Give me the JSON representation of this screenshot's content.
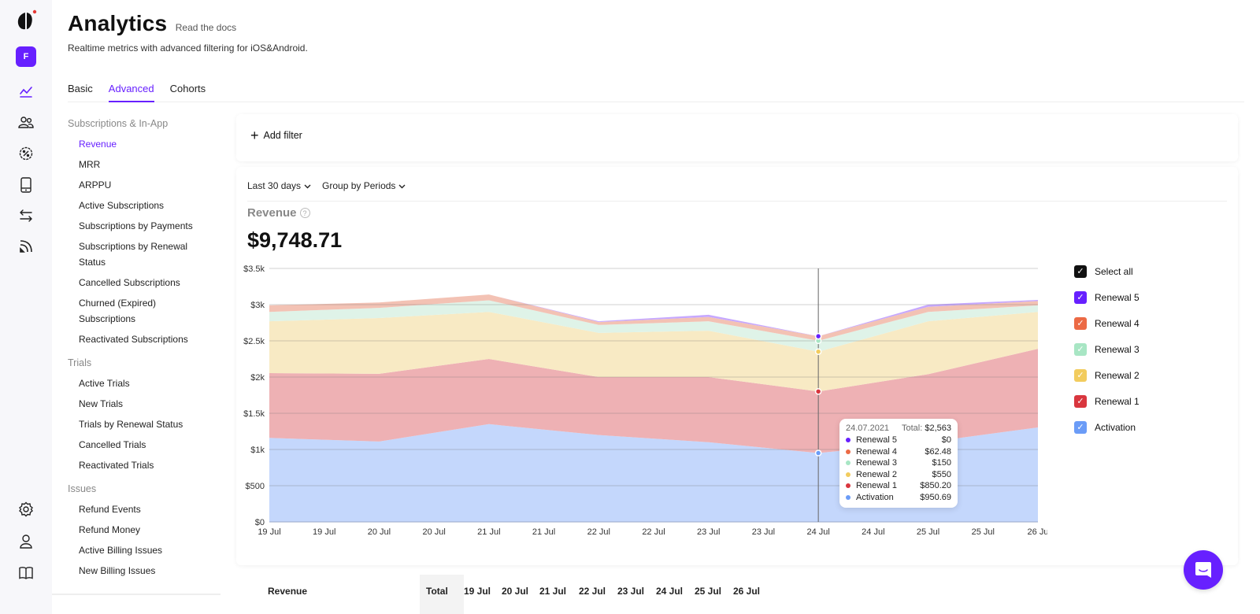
{
  "app": {
    "logo_icon": "brand-logo-icon",
    "avatar_letter": "F",
    "rail_icons": [
      "analytics-icon",
      "users-icon",
      "discount-icon",
      "device-icon",
      "transfer-icon",
      "feed-icon"
    ],
    "rail_bottom_icons": [
      "settings-icon",
      "profile-icon",
      "docs-book-icon"
    ]
  },
  "header": {
    "title": "Analytics",
    "docs_link": "Read the docs",
    "subtitle": "Realtime metrics with advanced filtering for iOS&Android."
  },
  "tabs": [
    {
      "label": "Basic",
      "active": false
    },
    {
      "label": "Advanced",
      "active": true
    },
    {
      "label": "Cohorts",
      "active": false
    }
  ],
  "nav": {
    "groups": [
      {
        "label": "Subscriptions & In-App",
        "items": [
          "Revenue",
          "MRR",
          "ARPPU",
          "Active Subscriptions",
          "Subscriptions by Payments",
          "Subscriptions by Renewal Status",
          "Cancelled Subscriptions",
          "Churned (Expired) Subscriptions",
          "Reactivated Subscriptions"
        ]
      },
      {
        "label": "Trials",
        "items": [
          "Active Trials",
          "New Trials",
          "Trials by Renewal Status",
          "Cancelled Trials",
          "Reactivated Trials"
        ]
      },
      {
        "label": "Issues",
        "items": [
          "Refund Events",
          "Refund Money",
          "Active Billing Issues",
          "New Billing Issues"
        ]
      }
    ],
    "active_item": "Revenue"
  },
  "filters": {
    "add_filter_label": "Add filter",
    "period_label": "Last 30 days",
    "group_label": "Group by Periods"
  },
  "metric": {
    "label": "Revenue",
    "value": "$9,748.71"
  },
  "legend": {
    "select_all": "Select all"
  },
  "tooltip": {
    "date": "24.07.2021",
    "total_label": "Total:",
    "total_value": "$2,563",
    "rows": [
      {
        "name": "Renewal 5",
        "value": "$0"
      },
      {
        "name": "Renewal 4",
        "value": "$62.48"
      },
      {
        "name": "Renewal 3",
        "value": "$150"
      },
      {
        "name": "Renewal 2",
        "value": "$550"
      },
      {
        "name": "Renewal 1",
        "value": "$850.20"
      },
      {
        "name": "Activation",
        "value": "$950.69"
      }
    ]
  },
  "table": {
    "header_label": "Revenue",
    "columns": [
      "Total",
      "19 Jul",
      "20 Jul",
      "21 Jul",
      "22 Jul",
      "23 Jul",
      "24 Jul",
      "25 Jul",
      "26 Jul"
    ]
  },
  "colors": {
    "accent": "#6720ff"
  },
  "chart_data": {
    "type": "area",
    "stacked": true,
    "title": "Revenue",
    "xlabel": "",
    "ylabel": "",
    "x": [
      "19 Jul",
      "20 Jul",
      "21 Jul",
      "22 Jul",
      "23 Jul",
      "24 Jul",
      "25 Jul",
      "26 Jul"
    ],
    "x_tick_labels": [
      "19 Jul",
      "19 Jul",
      "20 Jul",
      "20 Jul",
      "21 Jul",
      "21 Jul",
      "22 Jul",
      "22 Jul",
      "23 Jul",
      "23 Jul",
      "24 Jul",
      "24 Jul",
      "25 Jul",
      "25 Jul",
      "26 Ju"
    ],
    "ylim": [
      0,
      3500
    ],
    "y_ticks": [
      0,
      500,
      1000,
      1500,
      2000,
      2500,
      3000,
      3500
    ],
    "y_tick_labels": [
      "$0",
      "$500",
      "$1k",
      "$1.5k",
      "$2k",
      "$2.5k",
      "$3k",
      "$3.5k"
    ],
    "grid": true,
    "legend_position": "right",
    "highlight_index": 5,
    "series": [
      {
        "name": "Activation",
        "color": "#6b9cf7",
        "fill": "#c4d7fc",
        "values": [
          1160,
          1110,
          1350,
          1200,
          1100,
          950.69,
          1100,
          1305
        ]
      },
      {
        "name": "Renewal 1",
        "color": "#d9363e",
        "fill": "#eeb1b4",
        "values": [
          895,
          935,
          900,
          800,
          900,
          850.2,
          940,
          1085
        ]
      },
      {
        "name": "Renewal 2",
        "color": "#f2cc5e",
        "fill": "#f8eac4",
        "values": [
          715,
          770,
          650,
          610,
          640,
          550,
          730,
          510
        ]
      },
      {
        "name": "Renewal 3",
        "color": "#a8e6c4",
        "fill": "#dff3e8",
        "values": [
          130,
          140,
          160,
          110,
          130,
          150,
          130,
          90
        ]
      },
      {
        "name": "Renewal 4",
        "color": "#ec6a45",
        "fill": "#f3c2b4",
        "values": [
          90,
          75,
          80,
          40,
          60,
          62.48,
          70,
          60
        ]
      },
      {
        "name": "Renewal 5",
        "color": "#6720ff",
        "fill": "#c6a8ff",
        "values": [
          0,
          0,
          0,
          10,
          30,
          0,
          30,
          15
        ]
      }
    ]
  }
}
